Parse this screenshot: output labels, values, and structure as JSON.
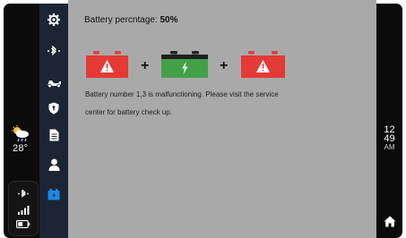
{
  "weather": {
    "temperature": "28°",
    "icon": "rainy-weather-icon"
  },
  "status": {
    "icons": [
      "bluetooth-icon",
      "signal-icon",
      "battery-status-icon"
    ]
  },
  "nav": {
    "items": [
      {
        "name": "settings",
        "icon": "gear-icon"
      },
      {
        "name": "bluetooth",
        "icon": "bluetooth-icon"
      },
      {
        "name": "scooter",
        "icon": "scooter-icon"
      },
      {
        "name": "security",
        "icon": "shield-icon"
      },
      {
        "name": "documents",
        "icon": "document-icon"
      },
      {
        "name": "profile",
        "icon": "person-icon"
      },
      {
        "name": "battery",
        "icon": "battery-icon",
        "active": true
      }
    ]
  },
  "battery_page": {
    "percentage_label": "Battery percntage:",
    "percentage_value": "50%",
    "batteries": [
      {
        "number": 1,
        "state": "malfunction",
        "color": "#e53935"
      },
      {
        "number": 2,
        "state": "ok",
        "color": "#43a047"
      },
      {
        "number": 3,
        "state": "malfunction",
        "color": "#e53935"
      }
    ],
    "plus_sign": "+",
    "message_line1": "Battery number 1,3 is malfunctioning. Please visit the service",
    "message_line2": "center for battery check up."
  },
  "clock": {
    "hour": "12",
    "minute": "49",
    "ampm": "AM"
  },
  "home": {
    "icon": "home-icon"
  },
  "colors": {
    "accent": "#1e88e5",
    "nav_bg": "#1b2533",
    "content_bg": "#a9a9a9"
  }
}
